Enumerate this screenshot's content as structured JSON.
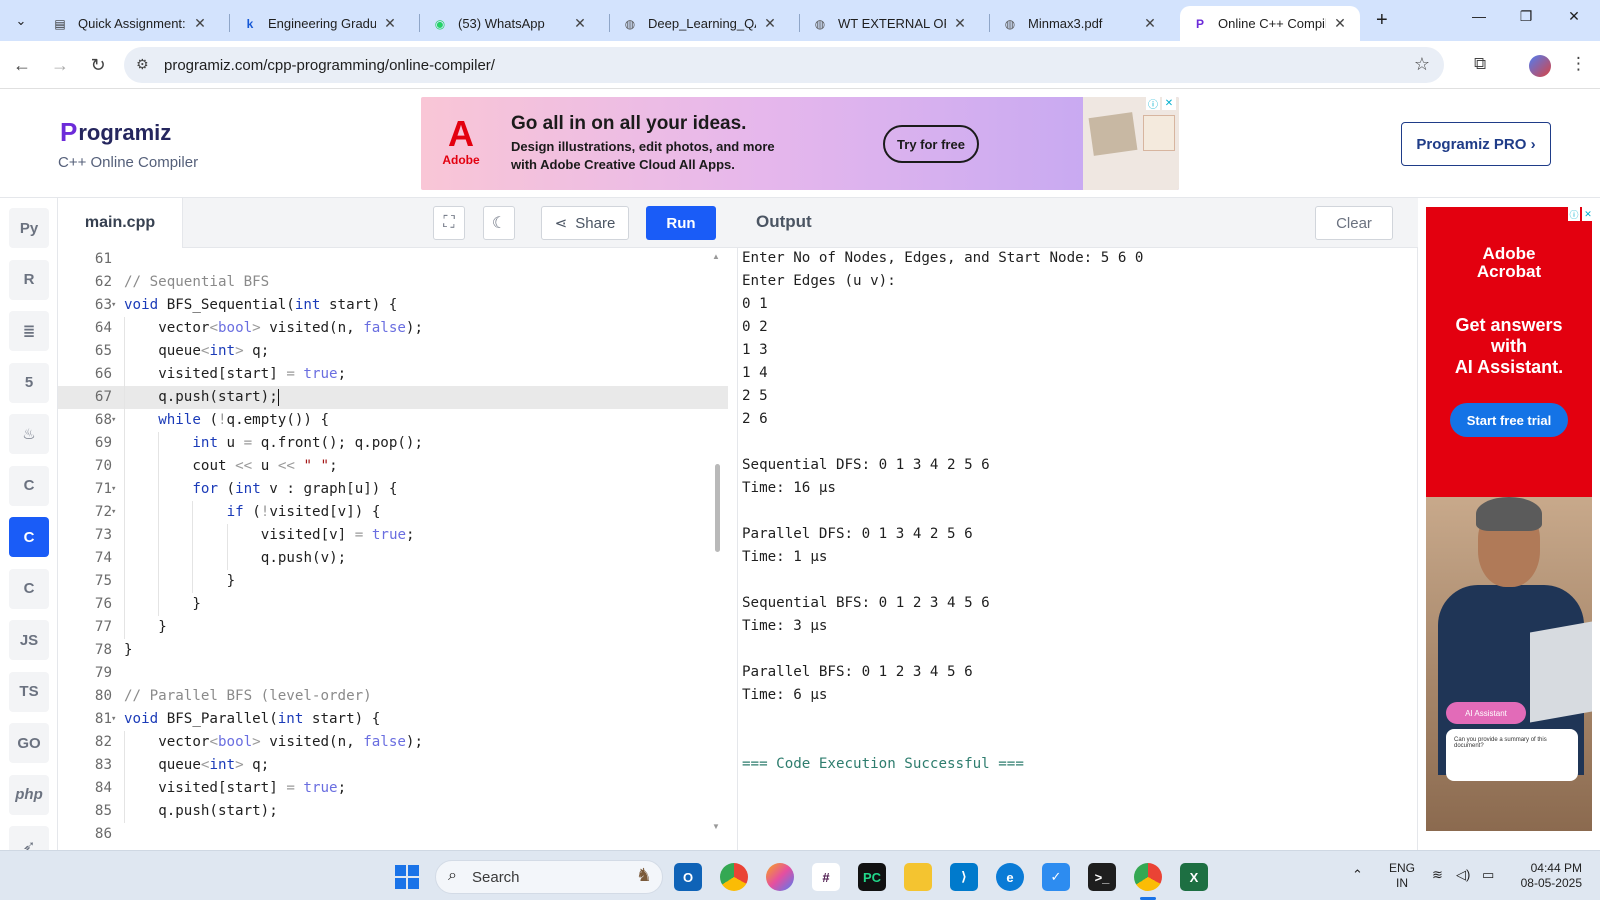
{
  "browser": {
    "tabs": [
      {
        "title": "Quick Assignment: S",
        "icon": "document-icon"
      },
      {
        "title": "Engineering Graduat",
        "icon": "k-icon"
      },
      {
        "title": "(53) WhatsApp",
        "icon": "whatsapp-icon"
      },
      {
        "title": "Deep_Learning_QA (",
        "icon": "globe-icon"
      },
      {
        "title": "WT EXTERNAL ORAL",
        "icon": "globe-icon"
      },
      {
        "title": "Minmax3.pdf",
        "icon": "globe-icon"
      },
      {
        "title": "Online C++ Compile",
        "icon": "programiz-icon",
        "active": true
      }
    ],
    "url": "programiz.com/cpp-programming/online-compiler/"
  },
  "site": {
    "logo_text": "rogramiz",
    "logo_mark": "P",
    "subtitle": "C++ Online Compiler",
    "pro_button": "Programiz PRO ›"
  },
  "top_ad": {
    "brand": "Adobe",
    "brand_mark": "A",
    "headline": "Go all in on all your ideas.",
    "body_line1": "Design illustrations, edit photos, and more",
    "body_line2": "with Adobe Creative Cloud All Apps.",
    "cta": "Try for free"
  },
  "rail": {
    "items": [
      "python-icon",
      "r-icon",
      "sql-icon",
      "html-icon",
      "java-icon",
      "c-icon",
      "cpp-icon",
      "csharp-icon",
      "JS",
      "TS",
      "GO",
      "php",
      "swift-icon"
    ],
    "active_index": 6
  },
  "editor": {
    "filename": "main.cpp",
    "share_label": "Share",
    "run_label": "Run",
    "current_line": 67,
    "lines": [
      {
        "n": "61",
        "fold": false,
        "indent": 0,
        "code": ""
      },
      {
        "n": "62",
        "fold": false,
        "indent": 0,
        "code": "// Sequential BFS"
      },
      {
        "n": "63",
        "fold": true,
        "indent": 0,
        "code": "void BFS_Sequential(int start) {"
      },
      {
        "n": "64",
        "fold": false,
        "indent": 1,
        "code": "vector<bool> visited(n, false);"
      },
      {
        "n": "65",
        "fold": false,
        "indent": 1,
        "code": "queue<int> q;"
      },
      {
        "n": "66",
        "fold": false,
        "indent": 1,
        "code": "visited[start] = true;"
      },
      {
        "n": "67",
        "fold": false,
        "indent": 1,
        "code": "q.push(start);"
      },
      {
        "n": "68",
        "fold": true,
        "indent": 1,
        "code": "while (!q.empty()) {"
      },
      {
        "n": "69",
        "fold": false,
        "indent": 2,
        "code": "int u = q.front(); q.pop();"
      },
      {
        "n": "70",
        "fold": false,
        "indent": 2,
        "code": "cout << u << \" \";"
      },
      {
        "n": "71",
        "fold": true,
        "indent": 2,
        "code": "for (int v : graph[u]) {"
      },
      {
        "n": "72",
        "fold": true,
        "indent": 3,
        "code": "if (!visited[v]) {"
      },
      {
        "n": "73",
        "fold": false,
        "indent": 4,
        "code": "visited[v] = true;"
      },
      {
        "n": "74",
        "fold": false,
        "indent": 4,
        "code": "q.push(v);"
      },
      {
        "n": "75",
        "fold": false,
        "indent": 3,
        "code": "}"
      },
      {
        "n": "76",
        "fold": false,
        "indent": 2,
        "code": "}"
      },
      {
        "n": "77",
        "fold": false,
        "indent": 1,
        "code": "}"
      },
      {
        "n": "78",
        "fold": false,
        "indent": 0,
        "code": "}"
      },
      {
        "n": "79",
        "fold": false,
        "indent": 0,
        "code": ""
      },
      {
        "n": "80",
        "fold": false,
        "indent": 0,
        "code": "// Parallel BFS (level-order)"
      },
      {
        "n": "81",
        "fold": true,
        "indent": 0,
        "code": "void BFS_Parallel(int start) {"
      },
      {
        "n": "82",
        "fold": false,
        "indent": 1,
        "code": "vector<bool> visited(n, false);"
      },
      {
        "n": "83",
        "fold": false,
        "indent": 1,
        "code": "queue<int> q;"
      },
      {
        "n": "84",
        "fold": false,
        "indent": 1,
        "code": "visited[start] = true;"
      },
      {
        "n": "85",
        "fold": false,
        "indent": 1,
        "code": "q.push(start);"
      },
      {
        "n": "86",
        "fold": false,
        "indent": 0,
        "code": ""
      }
    ]
  },
  "output": {
    "title": "Output",
    "clear_label": "Clear",
    "lines": [
      "Enter No of Nodes, Edges, and Start Node: 5 6 0",
      "Enter Edges (u v):",
      "0 1",
      "0 2",
      "1 3",
      "1 4",
      "2 5",
      "2 6",
      "",
      "Sequential DFS: 0 1 3 4 2 5 6",
      "Time: 16 μs",
      "",
      "Parallel DFS: 0 1 3 4 2 5 6",
      "Time: 1 μs",
      "",
      "Sequential BFS: 0 1 2 3 4 5 6",
      "Time: 3 μs",
      "",
      "Parallel BFS: 0 1 2 3 4 5 6",
      "Time: 6 μs",
      "",
      "",
      "=== Code Execution Successful ==="
    ]
  },
  "side_ad": {
    "brand_line1": "Adobe",
    "brand_line2": "Acrobat",
    "headline_line1": "Get answers",
    "headline_line2": "with",
    "headline_line3": "AI Assistant.",
    "cta": "Start free trial",
    "chip": "AI Assistant",
    "bubble": "Can you provide a summary of this document?"
  },
  "taskbar": {
    "search_label": "Search",
    "lang_line1": "ENG",
    "lang_line2": "IN",
    "time": "04:44 PM",
    "date": "08-05-2025"
  },
  "colors": {
    "accent": "#1a5cf7",
    "keyword": "#1b3bb8",
    "type": "#6a6ee0",
    "comment": "#8a8a8a",
    "success": "#2e7d6e",
    "adobe_red": "#e3000f"
  }
}
